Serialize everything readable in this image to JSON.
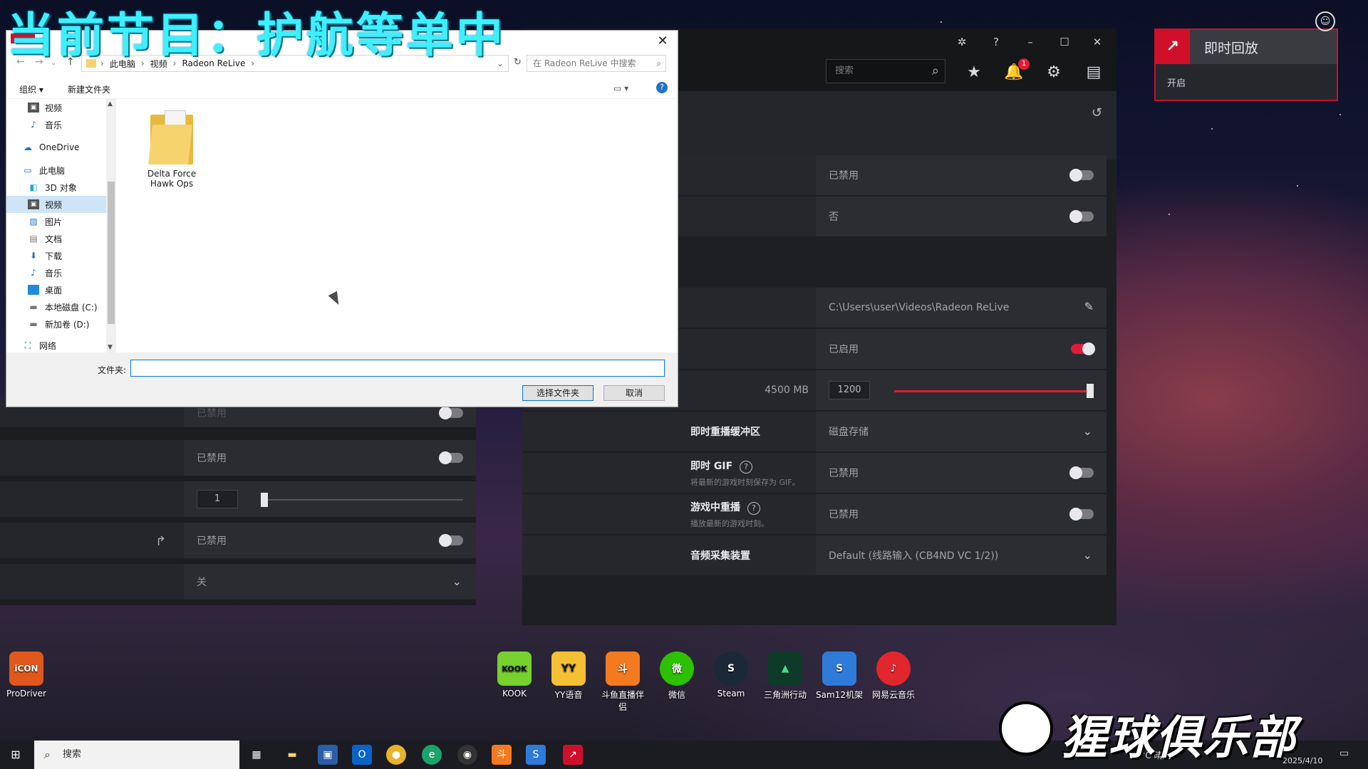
{
  "banner": {
    "text": "当前节目：护航等单中"
  },
  "dialog": {
    "address": {
      "crumbs": [
        "此电脑",
        "视频",
        "Radeon ReLive"
      ]
    },
    "search_placeholder": "在 Radeon ReLive 中搜索",
    "toolbar": {
      "organize": "组织 ▾",
      "new_folder": "新建文件夹"
    },
    "nav_items": [
      {
        "label": "视频",
        "icon": "video-icon"
      },
      {
        "label": "音乐",
        "icon": "music-icon"
      },
      {
        "label": "OneDrive",
        "icon": "cloud-icon"
      },
      {
        "label": "此电脑",
        "icon": "pc-icon"
      },
      {
        "label": "3D 对象",
        "icon": "cube-icon"
      },
      {
        "label": "视频",
        "icon": "video-icon",
        "selected": true
      },
      {
        "label": "图片",
        "icon": "picture-icon"
      },
      {
        "label": "文档",
        "icon": "document-icon"
      },
      {
        "label": "下载",
        "icon": "download-icon"
      },
      {
        "label": "音乐",
        "icon": "music-icon"
      },
      {
        "label": "桌面",
        "icon": "desktop-icon"
      },
      {
        "label": "本地磁盘 (C:)",
        "icon": "drive-icon"
      },
      {
        "label": "新加卷 (D:)",
        "icon": "drive-icon"
      },
      {
        "label": "网络",
        "icon": "network-icon"
      }
    ],
    "folder_name": "Delta Force Hawk Ops",
    "filename_label": "文件夹:",
    "filename_value": "",
    "select_button": "选择文件夹",
    "cancel_button": "取消"
  },
  "radeon": {
    "search_placeholder": "搜索",
    "notification_count": "1",
    "rows": [
      {
        "value": "已禁用",
        "control": "toggle-off"
      },
      {
        "value": "否",
        "control": "toggle-off"
      },
      {
        "value": "C:\\Users\\user\\Videos\\Radeon ReLive",
        "control": "edit"
      },
      {
        "value": "已启用",
        "control": "toggle-on"
      },
      {
        "label_right": "4500 MB",
        "value": "1200",
        "control": "slider",
        "slider_fraction": 1.0
      },
      {
        "label": "即时重播缓冲区",
        "value": "磁盘存储",
        "control": "dropdown"
      },
      {
        "label": "即时 GIF",
        "desc": "将最新的游戏时刻保存为 GIF。",
        "value": "已禁用",
        "control": "toggle-off"
      },
      {
        "label": "游戏中重播",
        "desc": "播放最新的游戏时刻。",
        "value": "已禁用",
        "control": "toggle-off"
      },
      {
        "label": "音频采集装置",
        "value": "Default (线路输入 (CB4ND VC 1/2))",
        "control": "dropdown"
      }
    ]
  },
  "left_panel": {
    "rows": [
      {
        "value": "已禁用",
        "control": "toggle-off"
      },
      {
        "value": "1",
        "control": "slider",
        "slider_fraction": 0.0
      },
      {
        "value": "已禁用",
        "control": "toggle-off"
      },
      {
        "value": "关",
        "control": "dropdown"
      }
    ]
  },
  "replay_overlay": {
    "title": "即时回放",
    "state": "开启"
  },
  "desktop_icons": [
    {
      "label": "ProDriver",
      "bg": "#e0581c",
      "text": "iCON"
    },
    {
      "label": "KOOK",
      "bg": "#77d12f",
      "text": "KOOK"
    },
    {
      "label": "YY语音",
      "bg": "#f5c132",
      "text": "YY"
    },
    {
      "label": "斗鱼直播伴侣",
      "bg": "#f47a20",
      "text": "斗"
    },
    {
      "label": "微信",
      "bg": "#2dc100",
      "text": "微"
    },
    {
      "label": "Steam",
      "bg": "#1b2838",
      "text": "S"
    },
    {
      "label": "三角洲行动",
      "bg": "#0e3a2a",
      "text": "▲"
    },
    {
      "label": "Sam12机架",
      "bg": "#2f7bd9",
      "text": "S"
    },
    {
      "label": "网易云音乐",
      "bg": "#e1262d",
      "text": "♪"
    }
  ],
  "watermark": {
    "text": "猩球俱乐部"
  },
  "taskbar": {
    "search_placeholder": "搜索",
    "weather": "25°C 晴朗",
    "ime": "中",
    "date": "2025/4/10"
  }
}
